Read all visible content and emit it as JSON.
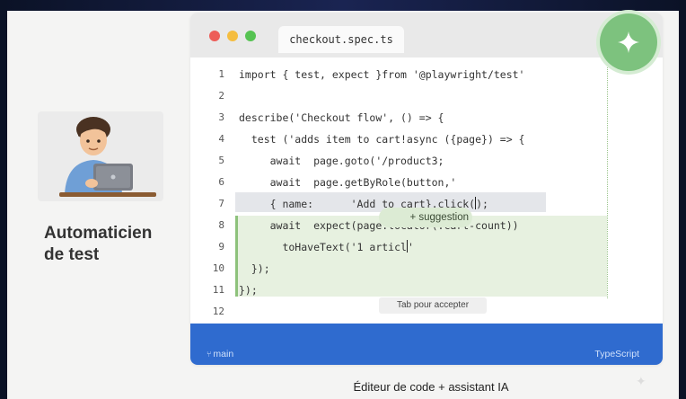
{
  "editor": {
    "file_tab": "checkout.spec.ts",
    "lines": [
      {
        "n": "1",
        "code": "import { test, expect }from '@playwright/test'"
      },
      {
        "n": "2",
        "code": ""
      },
      {
        "n": "3",
        "code": "describe('Checkout flow', () => {"
      },
      {
        "n": "4",
        "code": "  test ('adds item to cart!async ({page}) => {"
      },
      {
        "n": "5",
        "code": "     await  page.goto('/product3;"
      },
      {
        "n": "6",
        "code": "     await  page.getByRole(button,'"
      },
      {
        "n": "7",
        "code": "     { name:      'Add to cart}.click("
      },
      {
        "n": "8",
        "code": "     await  expect(page.locator(.cart-count))"
      },
      {
        "n": "9",
        "code": "       toHaveText('1 articl"
      },
      {
        "n": "10",
        "code": "  });"
      },
      {
        "n": "11",
        "code": "});"
      },
      {
        "n": "12",
        "code": ""
      }
    ],
    "line7_tail": ");",
    "line9_tail": "'",
    "suggestion_label": "+ suggestion",
    "tab_hint": "Tab pour accepter"
  },
  "statusbar": {
    "branch": "main",
    "language": "TypeScript"
  },
  "sidebar": {
    "role_line1": "Automaticien",
    "role_line2": "de test"
  },
  "caption": "Éditeur de code + assistant IA",
  "colors": {
    "statusbar": "#2f6bcf",
    "ai_button": "#7dc27e",
    "suggestion_bg": "#e7f1e0"
  },
  "icons": {
    "ai_button": "sparkle-icon",
    "branch": "git-branch-icon",
    "avatar": "developer-avatar-icon"
  }
}
